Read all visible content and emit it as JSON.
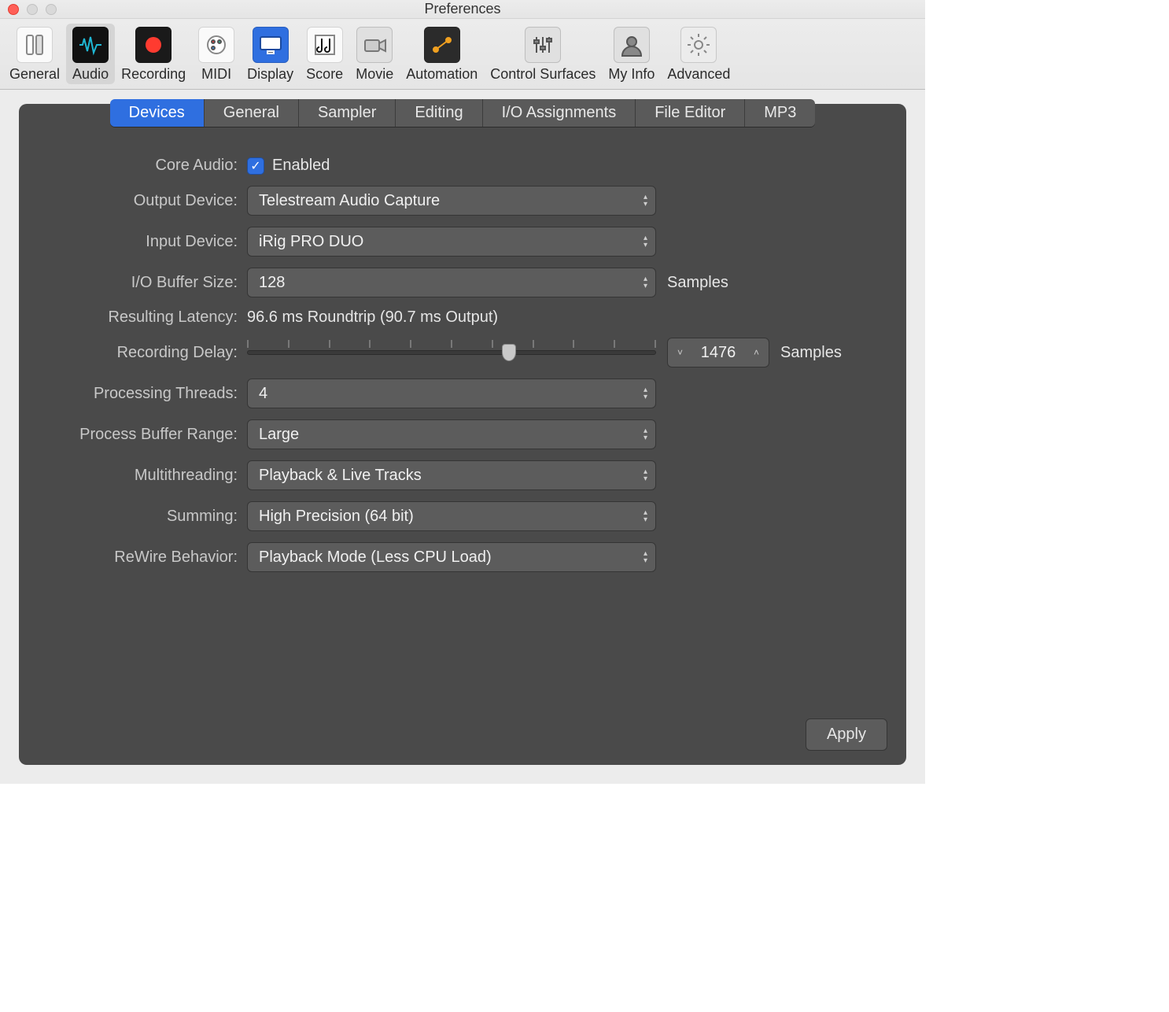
{
  "window": {
    "title": "Preferences"
  },
  "toolbar": [
    {
      "id": "general",
      "label": "General",
      "icon": "switch",
      "bg": "#fafafa",
      "fg": "#555"
    },
    {
      "id": "audio",
      "label": "Audio",
      "icon": "waveform",
      "bg": "#111",
      "fg": "#1fb7d4",
      "active": true
    },
    {
      "id": "recording",
      "label": "Recording",
      "icon": "rec",
      "bg": "#1a1a1a",
      "fg": "#ff3b30"
    },
    {
      "id": "midi",
      "label": "MIDI",
      "icon": "palette",
      "bg": "#fafafa",
      "fg": "#555"
    },
    {
      "id": "display",
      "label": "Display",
      "icon": "monitor",
      "bg": "#2f6fe0",
      "fg": "#fff"
    },
    {
      "id": "score",
      "label": "Score",
      "icon": "score",
      "bg": "#fafafa",
      "fg": "#111"
    },
    {
      "id": "movie",
      "label": "Movie",
      "icon": "camera",
      "bg": "#e0e0e0",
      "fg": "#444"
    },
    {
      "id": "automation",
      "label": "Automation",
      "icon": "automation",
      "bg": "#2b2b2b",
      "fg": "#f0a020"
    },
    {
      "id": "control",
      "label": "Control Surfaces",
      "icon": "sliders",
      "bg": "#e0e0e0",
      "fg": "#555"
    },
    {
      "id": "myinfo",
      "label": "My Info",
      "icon": "user",
      "bg": "#e0e0e0",
      "fg": "#555"
    },
    {
      "id": "advanced",
      "label": "Advanced",
      "icon": "gear",
      "bg": "#ececec",
      "fg": "#888"
    }
  ],
  "subtabs": [
    {
      "label": "Devices",
      "active": true
    },
    {
      "label": "General"
    },
    {
      "label": "Sampler"
    },
    {
      "label": "Editing"
    },
    {
      "label": "I/O Assignments"
    },
    {
      "label": "File Editor"
    },
    {
      "label": "MP3"
    }
  ],
  "form": {
    "core_audio": {
      "label": "Core Audio:",
      "enabled_label": "Enabled",
      "checked": true
    },
    "output_device": {
      "label": "Output Device:",
      "value": "Telestream Audio Capture"
    },
    "input_device": {
      "label": "Input Device:",
      "value": "iRig PRO DUO"
    },
    "io_buffer": {
      "label": "I/O Buffer Size:",
      "value": "128",
      "unit": "Samples"
    },
    "latency": {
      "label": "Resulting Latency:",
      "value": "96.6 ms Roundtrip (90.7 ms Output)"
    },
    "recording_delay": {
      "label": "Recording Delay:",
      "value": "1476",
      "unit": "Samples",
      "slider_pct": 64
    },
    "processing_threads": {
      "label": "Processing Threads:",
      "value": "4"
    },
    "process_buffer_range": {
      "label": "Process Buffer Range:",
      "value": "Large"
    },
    "multithreading": {
      "label": "Multithreading:",
      "value": "Playback & Live Tracks"
    },
    "summing": {
      "label": "Summing:",
      "value": "High Precision (64 bit)"
    },
    "rewire": {
      "label": "ReWire Behavior:",
      "value": "Playback Mode (Less CPU Load)"
    }
  },
  "apply_label": "Apply"
}
